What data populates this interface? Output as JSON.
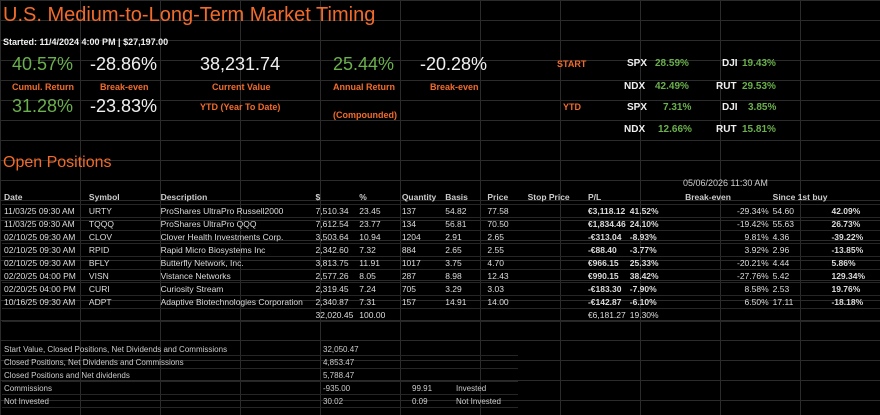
{
  "header": {
    "title": "U.S. Medium-to-Long-Term Market Timing",
    "started": "Started: 11/4/2024 4:00 PM | $27,197.00"
  },
  "summary": {
    "cumul_return": "40.57%",
    "cumul_return_label": "Cumul. Return",
    "breakeven_1": "-28.86%",
    "breakeven_1_label": "Break-even",
    "current_value": "38,231.74",
    "current_value_label": "Current Value",
    "annual_return": "25.44%",
    "annual_return_label": "Annual Return",
    "annual_return_sub": "(Compounded)",
    "breakeven_2": "-20.28%",
    "breakeven_2_label": "Break-even",
    "ytd_return": "31.28%",
    "ytd_breakeven": "-23.83%",
    "ytd_label": "YTD (Year To Date)"
  },
  "indices": {
    "start_label": "START",
    "ytd_label": "YTD",
    "start": {
      "spx_label": "SPX",
      "spx": "28.59%",
      "dji_label": "DJI",
      "dji": "19.43%",
      "ndx_label": "NDX",
      "ndx": "42.49%",
      "rut_label": "RUT",
      "rut": "29.53%"
    },
    "ytd": {
      "spx_label": "SPX",
      "spx": "7.31%",
      "dji_label": "DJI",
      "dji": "3.85%",
      "ndx_label": "NDX",
      "ndx": "12.66%",
      "rut_label": "RUT",
      "rut": "15.81%"
    }
  },
  "positions": {
    "title": "Open Positions",
    "timestamp": "05/06/2026 11:30 AM",
    "headers": [
      "Date",
      "Symbol",
      "Description",
      "$",
      "%",
      "Quantity",
      "Basis",
      "Price",
      "Stop Price",
      "P/L",
      "",
      "Break-even",
      "Since 1st buy",
      ""
    ],
    "rows": [
      [
        "11/03/25 09:30 AM",
        "URTY",
        "ProShares UltraPro Russell2000",
        "7,510.34",
        "23.45",
        "137",
        "54.82",
        "77.58",
        "",
        "€3,118.12",
        "41.52%",
        "-29.34%",
        "54.60",
        "42.09%"
      ],
      [
        "11/03/25 09:30 AM",
        "TQQQ",
        "ProShares UltraPro QQQ",
        "7,612.54",
        "23.77",
        "134",
        "56.81",
        "70.50",
        "",
        "€1,834.46",
        "24.10%",
        "-19.42%",
        "55.63",
        "26.73%"
      ],
      [
        "02/10/25 09:30 AM",
        "CLOV",
        "Clover Health Investments Corp.",
        "3,503.64",
        "10.94",
        "1204",
        "2.91",
        "2.65",
        "",
        "-€313.04",
        "-8.93%",
        "9.81%",
        "4.36",
        "-39.22%"
      ],
      [
        "02/10/25 09:30 AM",
        "RPID",
        "Rapid Micro Biosystems Inc",
        "2,342.60",
        "7.32",
        "884",
        "2.65",
        "2.55",
        "",
        "-€88.40",
        "-3.77%",
        "3.92%",
        "2.96",
        "-13.85%"
      ],
      [
        "02/10/25 09:30 AM",
        "BFLY",
        "Butterfly Network, Inc.",
        "3,813.75",
        "11.91",
        "1017",
        "3.75",
        "4.70",
        "",
        "€966.15",
        "25.33%",
        "-20.21%",
        "4.44",
        "5.86%"
      ],
      [
        "02/20/25 04:00 PM",
        "VISN",
        "Vistance Networks",
        "2,577.26",
        "8.05",
        "287",
        "8.98",
        "12.43",
        "",
        "€990.15",
        "38.42%",
        "-27.76%",
        "5.42",
        "129.34%"
      ],
      [
        "02/20/25 04:00 PM",
        "CURI",
        "Curiosity Stream",
        "2,319.45",
        "7.24",
        "705",
        "3.29",
        "3.03",
        "",
        "-€183.30",
        "-7.90%",
        "8.58%",
        "2.53",
        "19.76%"
      ],
      [
        "10/16/25 09:30 AM",
        "ADPT",
        "Adaptive Biotechnologies Corporation",
        "2,340.87",
        "7.31",
        "157",
        "14.91",
        "14.00",
        "",
        "-€142.87",
        "-6.10%",
        "6.50%",
        "17.11",
        "-18.18%"
      ]
    ],
    "totals": {
      "amount": "32,020.45",
      "pct": "100.00",
      "pl": "€6,181.27",
      "pl_pct": "19.30%"
    }
  },
  "bottom": {
    "rows": [
      [
        "Start Value, Closed Positions, Net Dividends and Commissions",
        "32,050.47",
        "",
        ""
      ],
      [
        "Closed Positions, Net Dividends and Commissions",
        "4,853.47",
        "",
        ""
      ],
      [
        "Closed Positions and Net dividends",
        "5,788.47",
        "",
        ""
      ],
      [
        "Commissions",
        "-935.00",
        "99.91",
        "Invested"
      ],
      [
        "Not Invested",
        "30.02",
        "0.09",
        "Not Invested"
      ]
    ]
  },
  "colors": {
    "accent": "#f26b2b",
    "positive": "#6ab04c",
    "negative": "#ff4d4d",
    "background": "#000000"
  }
}
